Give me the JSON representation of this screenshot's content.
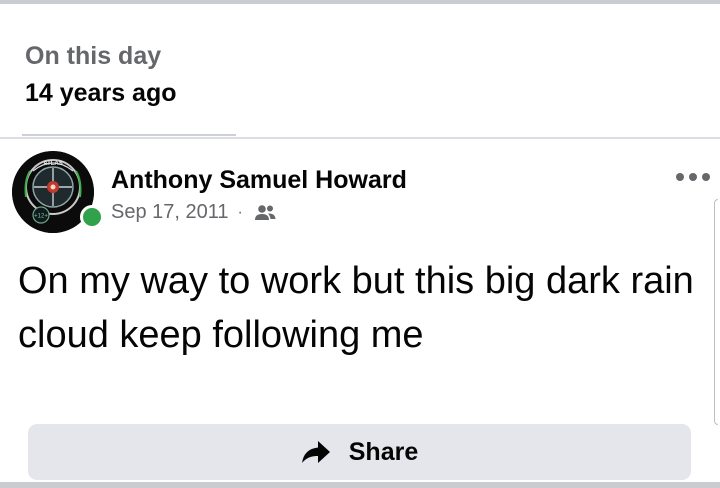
{
  "memory": {
    "subtitle": "On this day",
    "title": "14 years ago"
  },
  "post": {
    "author": "Anthony Samuel Howard",
    "date": "Sep 17, 2011",
    "separator": "·",
    "audience_icon": "friends-icon",
    "text": "On my way to work but this big dark rain cloud keep following me",
    "online": true,
    "online_color": "#31a24c"
  },
  "avatar": {
    "badge_text": "ATLAS",
    "sub_badge": "+12+"
  },
  "actions": {
    "share_label": "Share",
    "share_icon": "share-arrow-icon",
    "more_icon": "more-options-icon"
  }
}
